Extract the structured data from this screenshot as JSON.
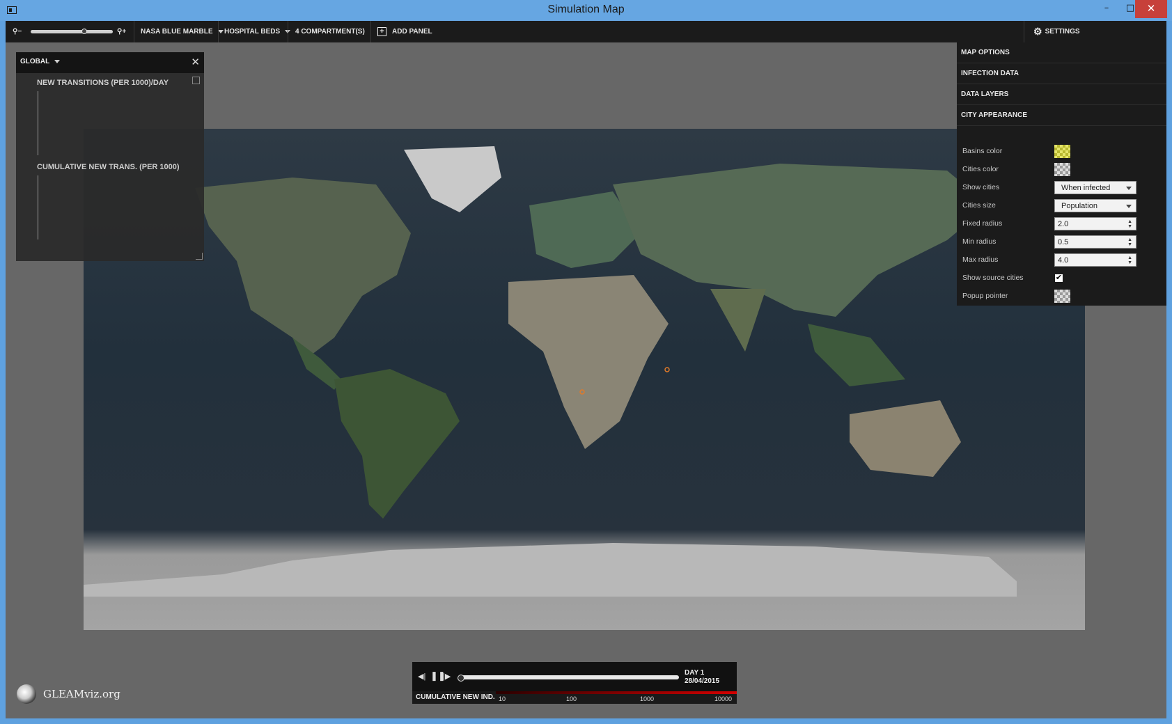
{
  "window": {
    "title": "Simulation Map",
    "min": "–",
    "max": "□",
    "close": "✕"
  },
  "toolbar": {
    "zoom_level": 0.65,
    "basemap": "NASA BLUE MARBLE",
    "layer": "HOSPITAL BEDS",
    "compartments": "4 COMPARTMENT(S)",
    "add_panel": "ADD PANEL",
    "settings": "SETTINGS"
  },
  "stats_panel": {
    "scope": "GLOBAL",
    "close": "✕",
    "chart1_title": "NEW TRANSITIONS (PER 1000)/DAY",
    "chart2_title": "CUMULATIVE NEW TRANS. (PER 1000)"
  },
  "settings_panel": {
    "sections": [
      "MAP OPTIONS",
      "INFECTION DATA",
      "DATA LAYERS",
      "CITY APPEARANCE"
    ],
    "basins_color_label": "Basins color",
    "cities_color_label": "Cities color",
    "show_cities_label": "Show cities",
    "show_cities_value": "When infected",
    "cities_size_label": "Cities size",
    "cities_size_value": "Population",
    "fixed_radius_label": "Fixed radius",
    "fixed_radius_value": "2.0",
    "min_radius_label": "Min radius",
    "min_radius_value": "0.5",
    "max_radius_label": "Max radius",
    "max_radius_value": "4.0",
    "show_source_label": "Show source cities",
    "show_source_checked": "✔",
    "popup_pointer_label": "Popup pointer"
  },
  "player": {
    "progress": 0.0,
    "day": "DAY 1",
    "date": "28/04/2015",
    "legend_title": "CUMULATIVE NEW IND.",
    "ticks": [
      "10",
      "100",
      "1000",
      "10000"
    ]
  },
  "branding": {
    "text": "GLEAMviz.org"
  },
  "colors": {
    "accent_red": "#d40000",
    "basins": "#e5e56a",
    "toolbar_bg": "#1b1b1b"
  }
}
